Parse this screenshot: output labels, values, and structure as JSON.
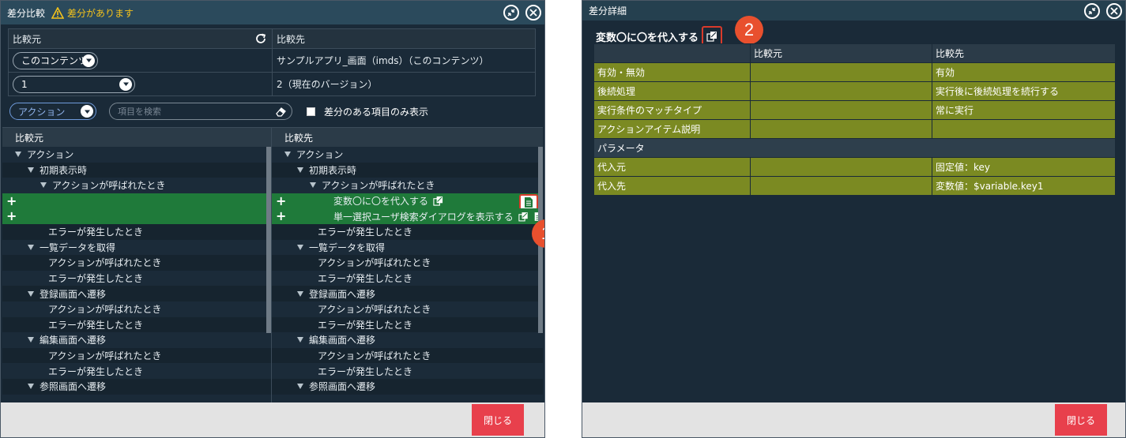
{
  "left_window": {
    "title": "差分比較",
    "warning": "差分があります",
    "source_label": "比較元",
    "target_label": "比較先",
    "source_content_select": "このコンテンツ",
    "target_content": "サンプルアプリ_画面（imds）（このコンテンツ）",
    "source_version_select": "1",
    "target_version": "2（現在のバージョン）",
    "filter_select": "アクション",
    "search_placeholder": "項目を検索",
    "diff_only_label": "差分のある項目のみ表示",
    "pane_left_header": "比較元",
    "pane_right_header": "比較先",
    "tree_left": [
      {
        "label": "アクション",
        "indent": 1,
        "tri": true
      },
      {
        "label": "初期表示時",
        "indent": 2,
        "tri": true
      },
      {
        "label": "アクションが呼ばれたとき",
        "indent": 3,
        "tri": true
      },
      {
        "label": "",
        "indent": 0,
        "added": true
      },
      {
        "label": "",
        "indent": 0,
        "added": true
      },
      {
        "label": "エラーが発生したとき",
        "indent": 4
      },
      {
        "label": "一覧データを取得",
        "indent": 2,
        "tri": true
      },
      {
        "label": "アクションが呼ばれたとき",
        "indent": 4
      },
      {
        "label": "エラーが発生したとき",
        "indent": 4
      },
      {
        "label": "登録画面へ遷移",
        "indent": 2,
        "tri": true
      },
      {
        "label": "アクションが呼ばれたとき",
        "indent": 4
      },
      {
        "label": "エラーが発生したとき",
        "indent": 4
      },
      {
        "label": "編集画面へ遷移",
        "indent": 2,
        "tri": true
      },
      {
        "label": "アクションが呼ばれたとき",
        "indent": 4
      },
      {
        "label": "エラーが発生したとき",
        "indent": 4
      },
      {
        "label": "参照画面へ遷移",
        "indent": 2,
        "tri": true
      }
    ],
    "tree_right": [
      {
        "label": "アクション",
        "indent": 1,
        "tri": true
      },
      {
        "label": "初期表示時",
        "indent": 2,
        "tri": true
      },
      {
        "label": "アクションが呼ばれたとき",
        "indent": 3,
        "tri": true
      },
      {
        "label": "変数〇に〇を代入する",
        "indent": 5,
        "added": true,
        "ext": true,
        "doc_highlight": true
      },
      {
        "label": "単一選択ユーザ検索ダイアログを表示する",
        "indent": 5,
        "added": true,
        "ext2": true
      },
      {
        "label": "エラーが発生したとき",
        "indent": 4
      },
      {
        "label": "一覧データを取得",
        "indent": 2,
        "tri": true
      },
      {
        "label": "アクションが呼ばれたとき",
        "indent": 4
      },
      {
        "label": "エラーが発生したとき",
        "indent": 4
      },
      {
        "label": "登録画面へ遷移",
        "indent": 2,
        "tri": true
      },
      {
        "label": "アクションが呼ばれたとき",
        "indent": 4
      },
      {
        "label": "エラーが発生したとき",
        "indent": 4
      },
      {
        "label": "編集画面へ遷移",
        "indent": 2,
        "tri": true
      },
      {
        "label": "アクションが呼ばれたとき",
        "indent": 4
      },
      {
        "label": "エラーが発生したとき",
        "indent": 4
      },
      {
        "label": "参照画面へ遷移",
        "indent": 2,
        "tri": true
      }
    ],
    "close_label": "閉じる",
    "badge": "1"
  },
  "right_window": {
    "title": "差分詳細",
    "heading": "変数〇に〇を代入する",
    "badge": "2",
    "col_source": "比較元",
    "col_target": "比較先",
    "rows": [
      {
        "name": "有効・無効",
        "source": "",
        "target": "有効",
        "kind": "diff"
      },
      {
        "name": "後続処理",
        "source": "",
        "target": "実行後に後続処理を続行する",
        "kind": "diff"
      },
      {
        "name": "実行条件のマッチタイプ",
        "source": "",
        "target": "常に実行",
        "kind": "diff"
      },
      {
        "name": "アクションアイテム説明",
        "source": "",
        "target": "",
        "kind": "diff"
      },
      {
        "name": "パラメータ",
        "source": "",
        "target": "",
        "kind": "group"
      },
      {
        "name": "代入元",
        "source": "",
        "target": "固定値：key",
        "kind": "diff"
      },
      {
        "name": "代入先",
        "source": "",
        "target": "変数値：$variable.key1",
        "kind": "diff"
      }
    ],
    "close_label": "閉じる"
  },
  "colors": {
    "title_bar": "#2b4a5c",
    "panel_bg": "#1a2a38",
    "added_row": "#1f7a3a",
    "diff_row": "#7b8a22",
    "close_button": "#e8404c",
    "badge": "#e8502e",
    "warning": "#f3c21c"
  }
}
